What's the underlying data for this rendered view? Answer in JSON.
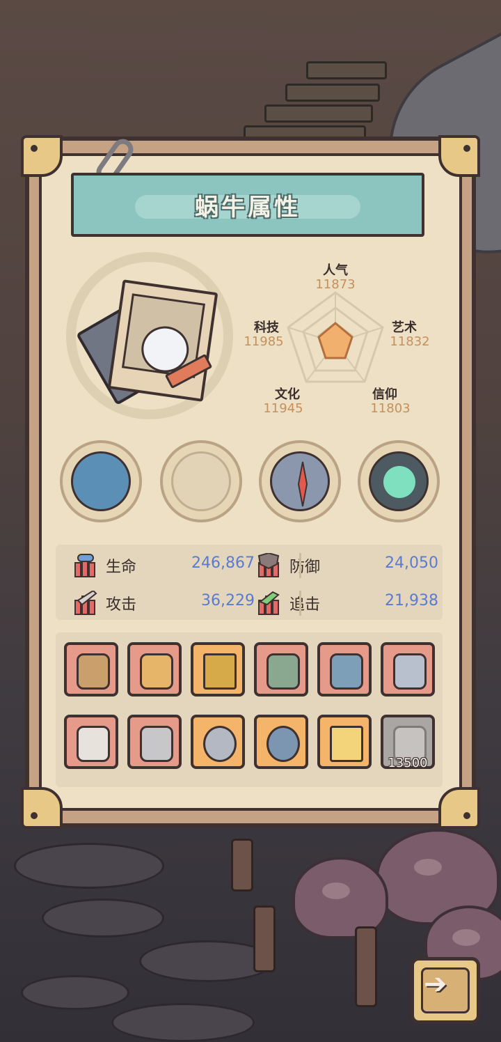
{
  "title": "蜗牛属性",
  "radar": {
    "axes": [
      {
        "label": "人气",
        "value": "11873"
      },
      {
        "label": "艺术",
        "value": "11832"
      },
      {
        "label": "信仰",
        "value": "11803"
      },
      {
        "label": "文化",
        "value": "11945"
      },
      {
        "label": "科技",
        "value": "11985"
      }
    ]
  },
  "medallions": [
    "spiky-monster-icon",
    "shell-icon",
    "compass-icon",
    "portal-icon"
  ],
  "stats": [
    {
      "name": "生命",
      "value": "246,867",
      "icon": "health-icon"
    },
    {
      "name": "防御",
      "value": "24,050",
      "icon": "defense-icon"
    },
    {
      "name": "攻击",
      "value": "36,229",
      "icon": "attack-icon"
    },
    {
      "name": "追击",
      "value": "21,938",
      "icon": "pursuit-icon"
    }
  ],
  "equipment": [
    {
      "icon": "crossbow-icon",
      "color": "#e69a8a"
    },
    {
      "icon": "mace-icon",
      "color": "#e69a8a"
    },
    {
      "icon": "crown-icon",
      "color": "#f4b46a"
    },
    {
      "icon": "hammer-icon",
      "color": "#e69a8a"
    },
    {
      "icon": "cannon-icon",
      "color": "#e69a8a"
    },
    {
      "icon": "scepter-icon",
      "color": "#e69a8a"
    },
    {
      "icon": "armor-icon",
      "color": "#e69a8a"
    },
    {
      "icon": "dagger-icon",
      "color": "#e69a8a"
    },
    {
      "icon": "ring-icon",
      "color": "#f4b46a"
    },
    {
      "icon": "diving-helmet-icon",
      "color": "#f4b46a"
    },
    {
      "icon": "sword-icon",
      "color": "#f4b46a"
    },
    {
      "icon": "rose-icon",
      "color": "#a9a6a4",
      "cost": "13500"
    }
  ],
  "next_button_icon": "arrow-right-icon"
}
